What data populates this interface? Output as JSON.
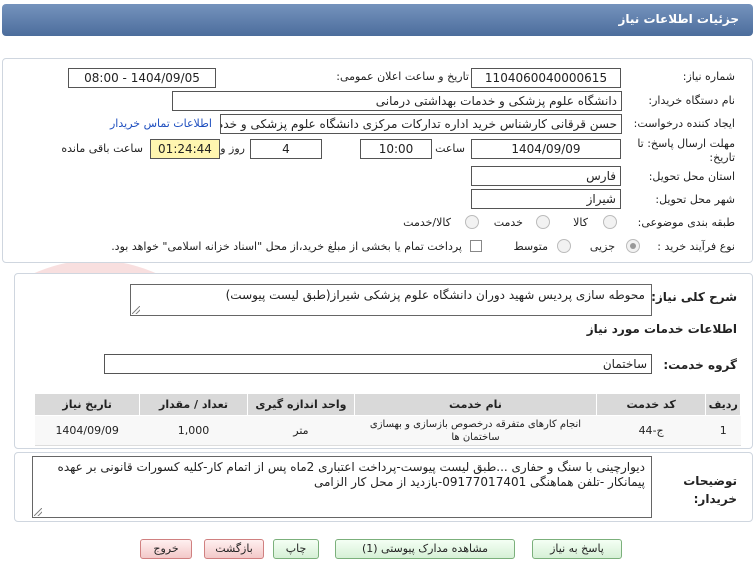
{
  "header": {
    "title": "جزئیات اطلاعات نیاز"
  },
  "info": {
    "need_number_label": "شماره نیاز:",
    "need_number": "1104060040000615",
    "announce_label": "تاریخ و ساعت اعلان عمومی:",
    "announce_value": "1404/09/05 - 08:00",
    "buyer_org_label": "نام دستگاه خریدار:",
    "buyer_org": "دانشگاه علوم پزشکی و خدمات بهداشتی درمانی",
    "creator_label": "ایجاد کننده درخواست:",
    "creator": "حسن قرقانی کارشناس خرید اداره تدارکات مرکزی دانشگاه علوم پزشکی و خدم",
    "contact_link": "اطلاعات تماس خریدار",
    "deadline_label": "مهلت ارسال پاسخ: تا تاریخ:",
    "deadline_date": "1404/09/09",
    "time_label": "ساعت",
    "deadline_time": "10:00",
    "days_value": "4",
    "days_label": "روز و",
    "remaining_time": "01:24:44",
    "remaining_label": "ساعت باقی مانده",
    "province_label": "استان محل تحویل:",
    "province": "فارس",
    "city_label": "شهر محل تحویل:",
    "city": "شیراز",
    "category_label": "طبقه بندی موضوعی:",
    "category_options": [
      "کالا",
      "خدمت",
      "کالا/خدمت"
    ],
    "process_label": "نوع فرآیند خرید :",
    "process_options": [
      "جزیی",
      "متوسط"
    ],
    "payment_note": "پرداخت تمام یا بخشی از مبلغ خرید،از محل \"اسناد خزانه اسلامی\" خواهد بود."
  },
  "needs": {
    "summary_label": "شرح کلی نیاز:",
    "summary": "محوطه سازی پردیس شهید دوران دانشگاه علوم پزشکی شیراز(طبق لیست پیوست)",
    "services_heading": "اطلاعات خدمات مورد نیاز",
    "group_label": "گروه خدمت:",
    "group": "ساختمان",
    "columns": [
      "ردیف",
      "کد خدمت",
      "نام خدمت",
      "واحد اندازه گیری",
      "تعداد / مقدار",
      "تاریخ نیاز"
    ],
    "rows": [
      {
        "row": "1",
        "code": "ج-44",
        "name": "انجام کارهای متفرقه درخصوص بازسازی و بهسازی ساختمان ها",
        "unit": "متر",
        "qty": "1,000",
        "date": "1404/09/09"
      }
    ],
    "buyer_notes_label": "توضیحات خریدار:",
    "buyer_notes": "دیوارچینی با سنگ و حفاری ...طبق لیست پیوست-پرداخت اعتباری 2ماه پس از اتمام کار-کلیه کسورات قانونی بر عهده پیمانکار -تلفن هماهنگی 09177017401-بازدید از محل کار الزامی"
  },
  "buttons": {
    "reply": "پاسخ به نیاز",
    "view_docs": "مشاهده مدارک پیوستی (1)",
    "print": "چاپ",
    "back": "بازگشت",
    "exit": "خروج"
  },
  "watermark": "AriaTender.net"
}
